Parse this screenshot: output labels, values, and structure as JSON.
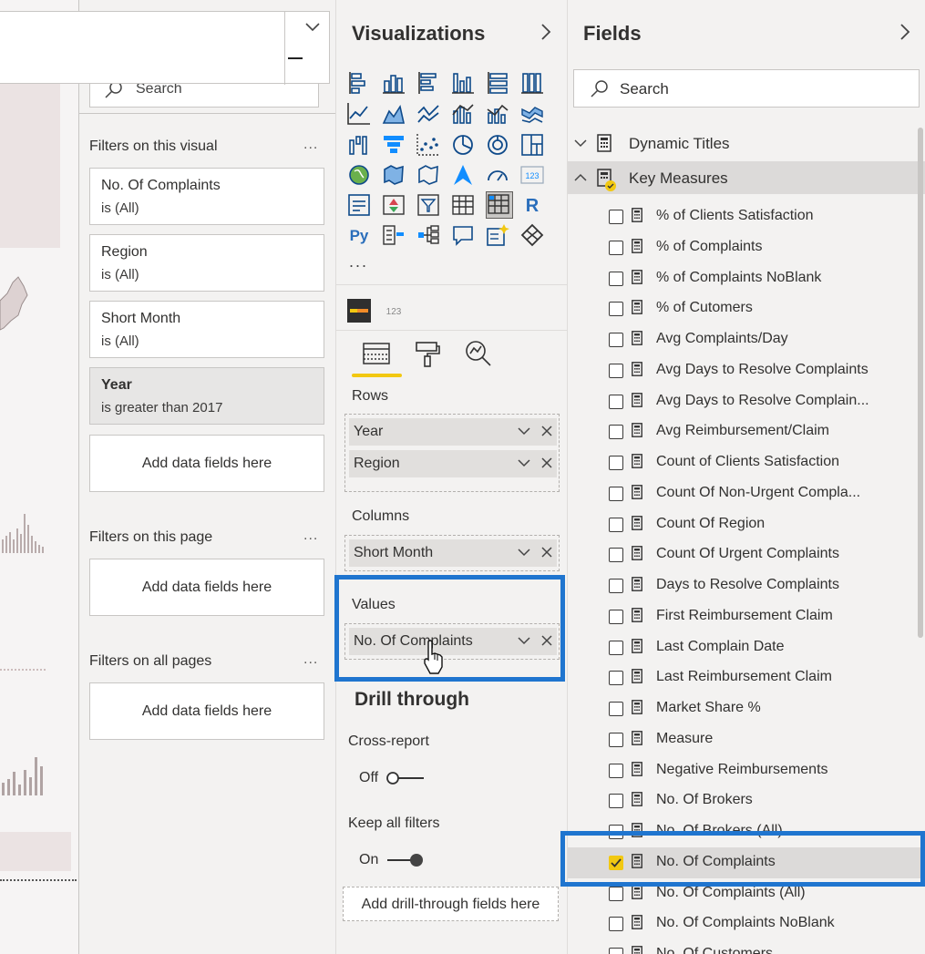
{
  "filter_pane": {
    "search_placeholder": "Search",
    "visual_section": "Filters on this visual",
    "page_section": "Filters on this page",
    "all_section": "Filters on all pages",
    "more": "...",
    "cards": [
      {
        "title": "No. Of Complaints",
        "state": "is (All)"
      },
      {
        "title": "Region",
        "state": "is (All)"
      },
      {
        "title": "Short Month",
        "state": "is (All)"
      },
      {
        "title": "Year",
        "state": "is greater than 2017"
      }
    ],
    "add_fields": "Add data fields here"
  },
  "visualizations": {
    "title": "Visualizations",
    "more_visuals": "...",
    "icons": [
      "stacked-bar-chart",
      "stacked-column-chart",
      "clustered-bar-chart",
      "clustered-column-chart",
      "100-stacked-bar-chart",
      "100-stacked-column-chart",
      "line-chart",
      "area-chart",
      "stacked-area-chart",
      "line-and-stacked-column-chart",
      "line-and-clustered-column-chart",
      "ribbon-chart",
      "waterfall-chart",
      "funnel-chart",
      "scatter-chart",
      "pie-chart",
      "donut-chart",
      "treemap",
      "map",
      "filled-map",
      "shape-map",
      "azure-map",
      "gauge",
      "card",
      "multi-row-card",
      "kpi",
      "slicer",
      "table",
      "matrix",
      "r-visual",
      "python-visual",
      "key-influencers",
      "decomposition-tree",
      "qa-visual",
      "smart-narrative",
      "power-apps"
    ],
    "icon_labels": {
      "card": "123",
      "r": "R",
      "py": "Py",
      "custom_small": "123"
    },
    "tabs": [
      "fields-tab",
      "format-tab",
      "analytics-tab"
    ],
    "rows_label": "Rows",
    "rows": [
      "Year",
      "Region"
    ],
    "columns_label": "Columns",
    "columns": [
      "Short Month"
    ],
    "values_label": "Values",
    "values": [
      "No. Of Complaints"
    ],
    "drill_title": "Drill through",
    "cross_report_label": "Cross-report",
    "cross_report_value": "Off",
    "keep_filters_label": "Keep all filters",
    "keep_filters_value": "On",
    "drill_add": "Add drill-through fields here"
  },
  "fields": {
    "title": "Fields",
    "search_placeholder": "Search",
    "tables": [
      {
        "name": "Dynamic Titles",
        "expanded": false
      },
      {
        "name": "Key Measures",
        "expanded": true
      }
    ],
    "measures": [
      {
        "name": "% of Clients Satisfaction",
        "checked": false
      },
      {
        "name": "% of Complaints",
        "checked": false
      },
      {
        "name": "% of Complaints NoBlank",
        "checked": false
      },
      {
        "name": "% of Cutomers",
        "checked": false
      },
      {
        "name": "Avg Complaints/Day",
        "checked": false
      },
      {
        "name": "Avg Days to Resolve Complaints",
        "checked": false
      },
      {
        "name": "Avg Days to Resolve Complain...",
        "checked": false
      },
      {
        "name": "Avg Reimbursement/Claim",
        "checked": false
      },
      {
        "name": "Count of Clients Satisfaction",
        "checked": false
      },
      {
        "name": "Count Of Non-Urgent Compla...",
        "checked": false
      },
      {
        "name": "Count Of Region",
        "checked": false
      },
      {
        "name": "Count Of Urgent Complaints",
        "checked": false
      },
      {
        "name": "Days to Resolve Complaints",
        "checked": false
      },
      {
        "name": "First Reimbursement Claim",
        "checked": false
      },
      {
        "name": "Last Complain Date",
        "checked": false
      },
      {
        "name": "Last Reimbursement Claim",
        "checked": false
      },
      {
        "name": "Market Share %",
        "checked": false
      },
      {
        "name": "Measure",
        "checked": false
      },
      {
        "name": "Negative Reimbursements",
        "checked": false
      },
      {
        "name": "No. Of Brokers",
        "checked": false
      },
      {
        "name": "No. Of Brokers (All)",
        "checked": false
      },
      {
        "name": "No. Of Complaints",
        "checked": true
      },
      {
        "name": "No. Of Complaints (All)",
        "checked": false
      },
      {
        "name": "No. Of Complaints NoBlank",
        "checked": false
      },
      {
        "name": "No. Of Customers",
        "checked": false
      }
    ]
  },
  "colors": {
    "accent_yellow": "#f2c811",
    "highlight_blue": "#1f75cf",
    "icon_blue": "#118dff",
    "pane_bg": "#f3f2f1"
  }
}
